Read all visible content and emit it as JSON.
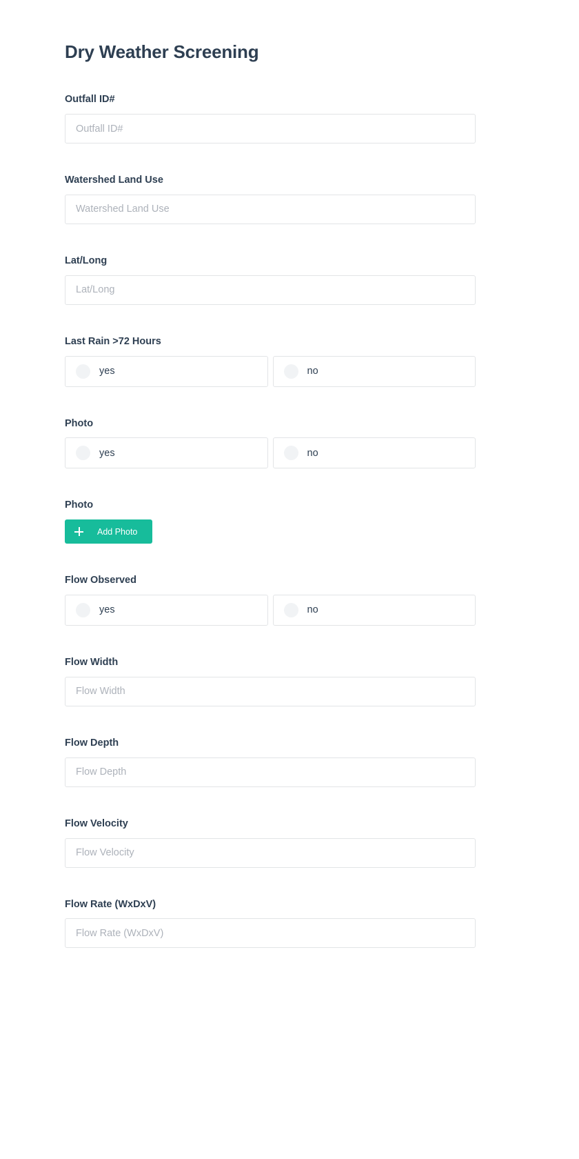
{
  "page": {
    "title": "Dry Weather Screening",
    "accent_color": "#17bc9b",
    "label_color": "#2e3f52",
    "placeholder_color": "#adb2ba",
    "border_color": "#e2e4e6",
    "background_color": "#ffffff"
  },
  "fields": {
    "outfall_id": {
      "label": "Outfall ID#",
      "placeholder": "Outfall ID#",
      "value": ""
    },
    "watershed_land_use": {
      "label": "Watershed Land Use",
      "placeholder": "Watershed Land Use",
      "value": ""
    },
    "lat_long": {
      "label": "Lat/Long",
      "placeholder": "Lat/Long",
      "value": ""
    },
    "last_rain": {
      "label": "Last Rain >72 Hours",
      "options": [
        "yes",
        "no"
      ]
    },
    "photo_yes_no": {
      "label": "Photo",
      "options": [
        "yes",
        "no"
      ]
    },
    "photo_upload": {
      "label": "Photo",
      "button_label": "Add Photo",
      "button_icon": "plus-icon"
    },
    "flow_observed": {
      "label": "Flow Observed",
      "options": [
        "yes",
        "no"
      ]
    },
    "flow_width": {
      "label": "Flow Width",
      "placeholder": "Flow Width",
      "value": ""
    },
    "flow_depth": {
      "label": "Flow Depth",
      "placeholder": "Flow Depth",
      "value": ""
    },
    "flow_velocity": {
      "label": "Flow Velocity",
      "placeholder": "Flow Velocity",
      "value": ""
    },
    "flow_rate": {
      "label": "Flow Rate (WxDxV)",
      "placeholder": "Flow Rate (WxDxV)",
      "value": ""
    }
  }
}
